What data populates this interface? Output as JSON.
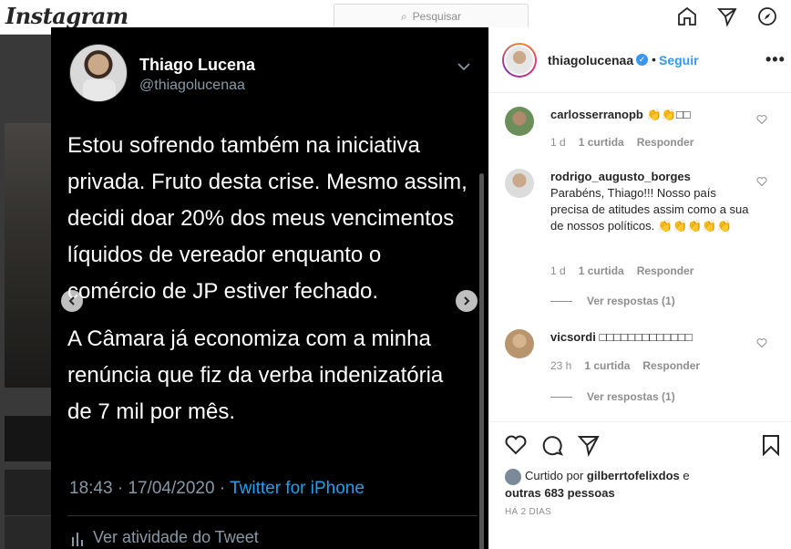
{
  "ig": {
    "logo": "Instagram",
    "search_placeholder": "Pesquisar"
  },
  "tweet": {
    "name": "Thiago Lucena",
    "handle": "@thiagolucenaa",
    "paragraph1": "Estou sofrendo também na iniciativa privada. Fruto desta crise. Mesmo assim, decidi doar 20% dos meus vencimentos líquidos de vereador enquanto o comércio de JP estiver fechado.",
    "paragraph2": "A Câmara já economiza com a minha renúncia que fiz da verba indenizatória de 7 mil por mês.",
    "time": "18:43 · 17/04/2020 · ",
    "source": "Twitter for iPhone",
    "activity": "Ver atividade do Tweet"
  },
  "post": {
    "username": "thiagolucenaa",
    "follow_label": "Seguir",
    "more": "•••"
  },
  "comments": [
    {
      "user": "carlosserranopb",
      "text": "👏👏□□",
      "age": "1 d",
      "likes": "1 curtida",
      "reply": "Responder"
    },
    {
      "user": "rodrigo_augusto_borges",
      "text": "Parabéns, Thiago!!! Nosso país precisa de atitudes assim como a sua de nossos políticos. 👏👏👏👏👏",
      "age": "1 d",
      "likes": "1 curtida",
      "reply": "Responder",
      "view_replies": "Ver respostas (1)"
    },
    {
      "user": "vicsordi",
      "text": "□□□□□□□□□□□□□",
      "age": "23 h",
      "likes": "1 curtida",
      "reply": "Responder",
      "view_replies": "Ver respostas (1)"
    }
  ],
  "likes": {
    "prefix": "Curtido por ",
    "user": "gilberrtofelixdos",
    "middle": " e ",
    "others": "outras 683 pessoas"
  },
  "date": "HÁ 2 DIAS"
}
